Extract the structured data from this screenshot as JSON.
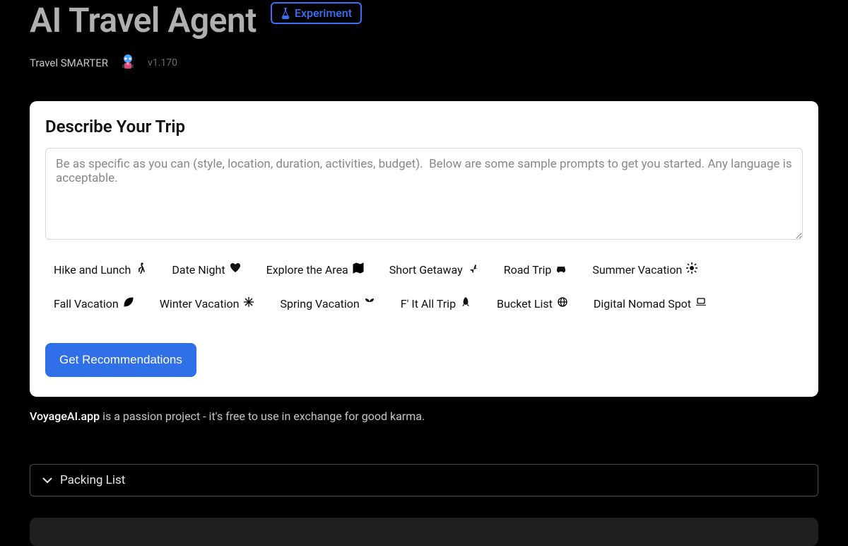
{
  "header": {
    "title": "AI Travel Agent",
    "badge_label": "Experiment",
    "tagline": "Travel SMARTER",
    "version": "v1.170"
  },
  "card": {
    "heading": "Describe Your Trip",
    "placeholder": "Be as specific as you can (style, location, duration, activities, budget).  Below are some sample prompts to get you started. Any language is acceptable.",
    "value": "",
    "cta": "Get Recommendations"
  },
  "prompts": [
    {
      "label": "Hike and Lunch",
      "icon": "hiking"
    },
    {
      "label": "Date Night",
      "icon": "heart"
    },
    {
      "label": "Explore the Area",
      "icon": "map"
    },
    {
      "label": "Short Getaway",
      "icon": "plane"
    },
    {
      "label": "Road Trip",
      "icon": "car"
    },
    {
      "label": "Summer Vacation",
      "icon": "sun"
    },
    {
      "label": "Fall Vacation",
      "icon": "leaf"
    },
    {
      "label": "Winter Vacation",
      "icon": "snowflake"
    },
    {
      "label": "Spring Vacation",
      "icon": "seedling"
    },
    {
      "label": "F' It All Trip",
      "icon": "rocket"
    },
    {
      "label": "Bucket List",
      "icon": "globe"
    },
    {
      "label": "Digital Nomad Spot",
      "icon": "laptop"
    }
  ],
  "footer": {
    "brand": "VoyageAI.app",
    "rest": " is a passion project - it's free to use in exchange for good karma."
  },
  "accordion": {
    "label": "Packing List"
  }
}
